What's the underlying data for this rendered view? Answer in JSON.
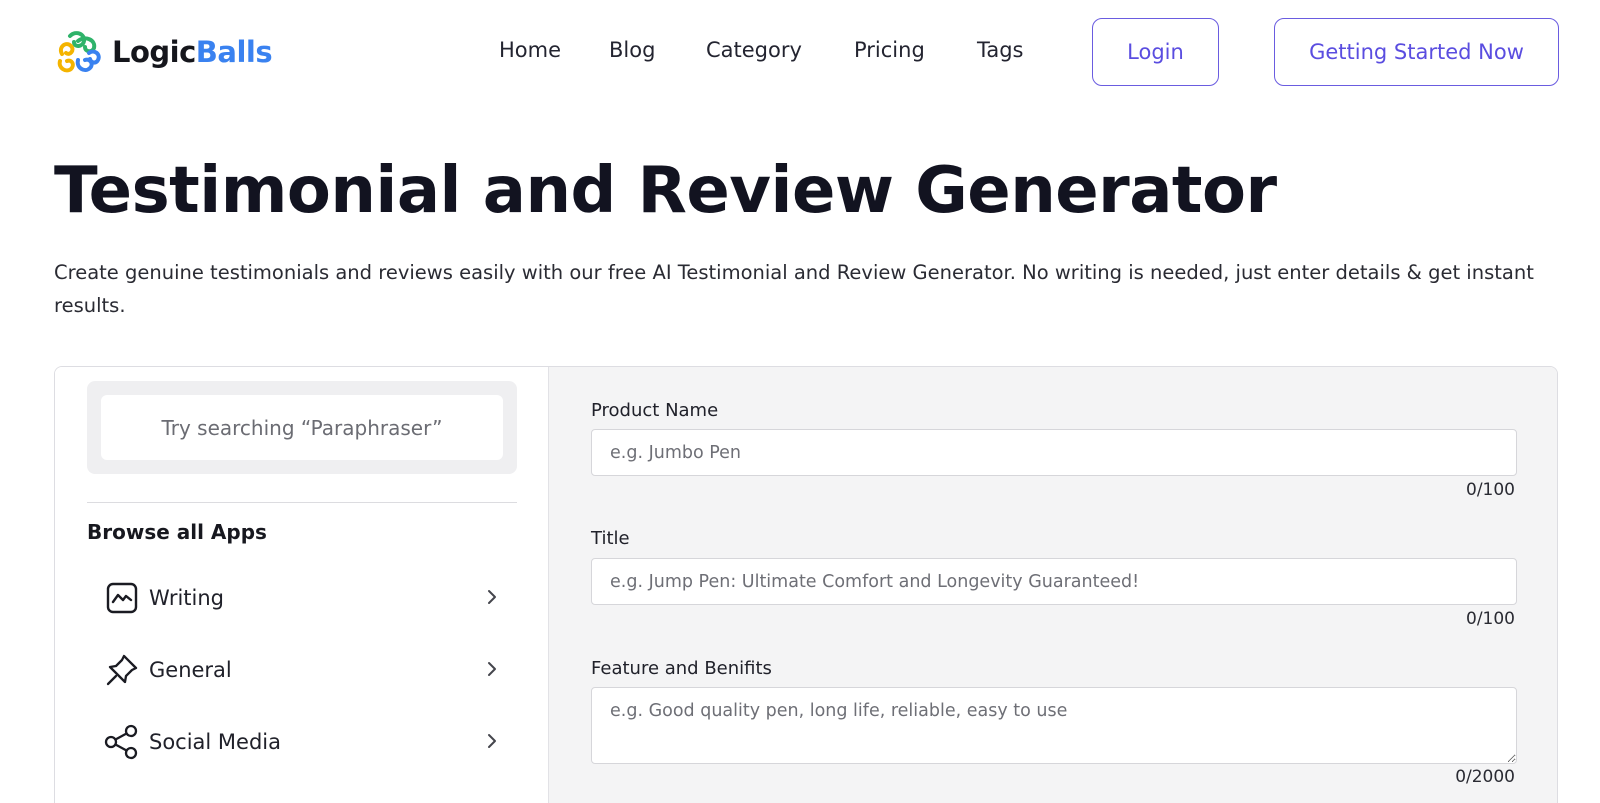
{
  "brand": {
    "name_part1": "Logic",
    "name_part2": "Balls",
    "colors": {
      "green": "#2fb36a",
      "yellow": "#f4b400",
      "blue": "#3a82f0",
      "accent": "#5a4de0"
    }
  },
  "nav": {
    "items": [
      "Home",
      "Blog",
      "Category",
      "Pricing",
      "Tags"
    ],
    "login_label": "Login",
    "cta_label": "Getting Started Now"
  },
  "hero": {
    "title": "Testimonial and Review Generator",
    "subtitle": "Create genuine testimonials and reviews easily with our free AI Testimonial and Review Generator. No writing is needed, just enter details & get instant results."
  },
  "sidebar": {
    "search_placeholder": "Try searching “Paraphraser”",
    "browse_title": "Browse all Apps",
    "categories": [
      {
        "label": "Writing",
        "icon": "chart-line-icon"
      },
      {
        "label": "General",
        "icon": "pin-icon"
      },
      {
        "label": "Social Media",
        "icon": "share-icon"
      }
    ]
  },
  "form": {
    "product_name": {
      "label": "Product Name",
      "placeholder": "e.g. Jumbo Pen",
      "value": "",
      "counter": "0/100"
    },
    "title": {
      "label": "Title",
      "placeholder": "e.g. Jump Pen: Ultimate Comfort and Longevity Guaranteed!",
      "value": "",
      "counter": "0/100"
    },
    "features": {
      "label": "Feature and Benifits",
      "placeholder": "e.g. Good quality pen, long life, reliable, easy to use",
      "value": "",
      "counter": "0/2000"
    }
  }
}
